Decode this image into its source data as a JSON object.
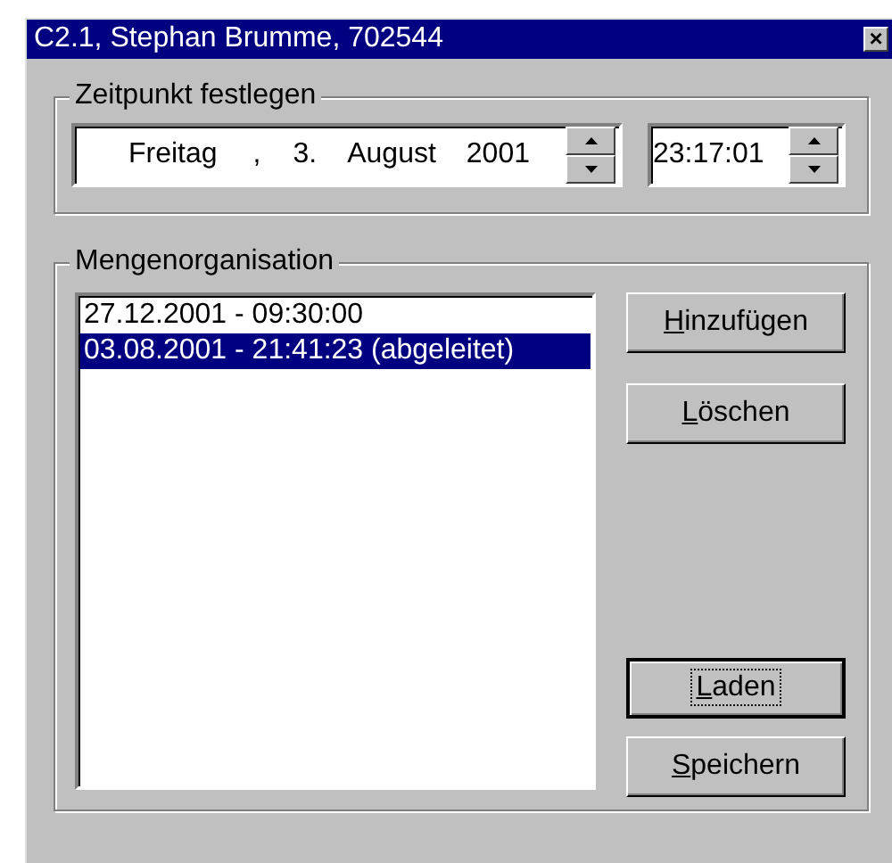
{
  "window": {
    "title": "C2.1, Stephan Brumme, 702544",
    "close": "×"
  },
  "timepoint": {
    "title": "Zeitpunkt festlegen",
    "date_parts": [
      "Freitag",
      ",",
      "3.",
      "August",
      "2001"
    ],
    "time": "23:17:01"
  },
  "set_organisation": {
    "title": "Mengenorganisation",
    "items": [
      {
        "text": "27.12.2001 - 09:30:00",
        "selected": false
      },
      {
        "text": "03.08.2001 - 21:41:23 (abgeleitet)",
        "selected": true
      }
    ],
    "buttons_top": [
      {
        "label": "Hinzufügen",
        "focused": false
      },
      {
        "label": "Löschen",
        "focused": false
      }
    ],
    "buttons_bottom": [
      {
        "label": "Laden",
        "focused": true
      },
      {
        "label": "Speichern",
        "focused": false
      }
    ]
  }
}
